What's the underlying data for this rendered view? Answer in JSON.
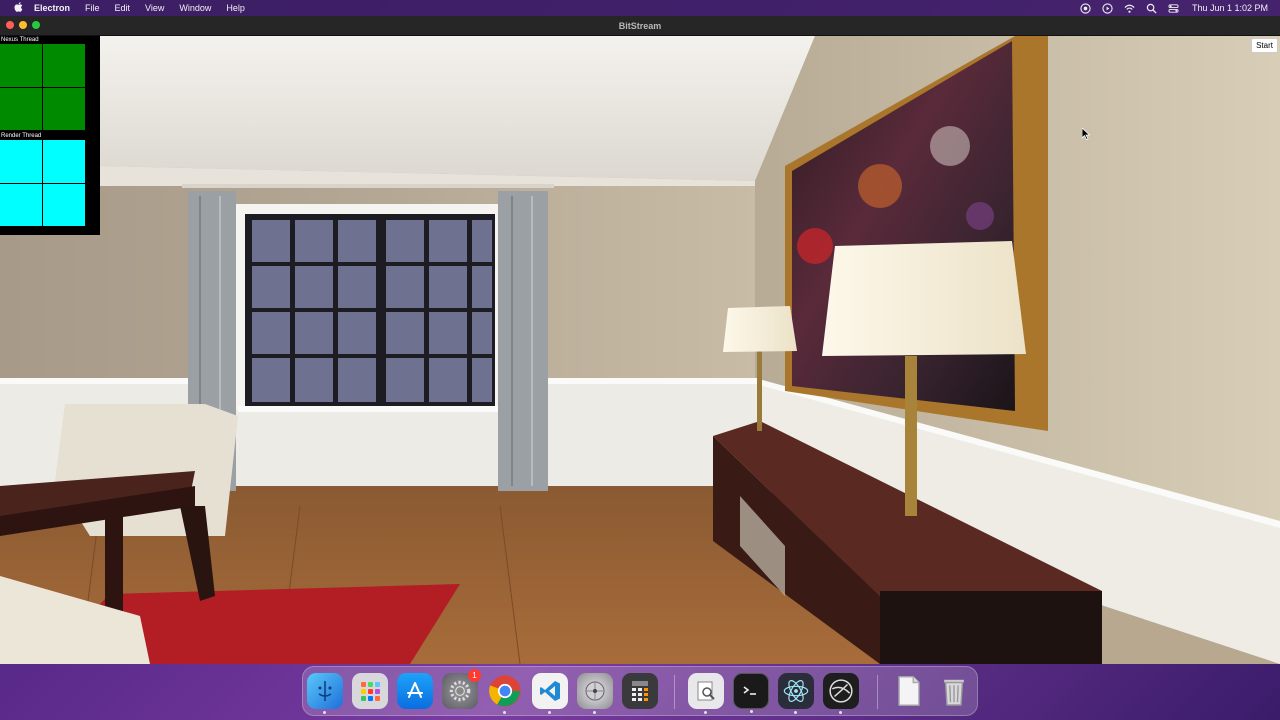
{
  "menubar": {
    "apple_icon": "apple-logo-icon",
    "app_name": "Electron",
    "items": [
      "File",
      "Edit",
      "View",
      "Window",
      "Help"
    ],
    "status_icons": [
      "screen-mirroring-icon",
      "media-play-icon",
      "wifi-icon",
      "search-icon",
      "control-center-icon"
    ],
    "clock": "Thu Jun 1  1:02 PM"
  },
  "window": {
    "title": "BitStream",
    "traffic_lights": {
      "close": "#ff5f57",
      "minimize": "#febc2e",
      "zoom": "#28c840"
    }
  },
  "debug": {
    "nexus_label": "Nexus Thread",
    "render_label": "Render Thread",
    "nexus_color": "#008a00",
    "render_color": "#00ffff"
  },
  "controls": {
    "start_label": "Start"
  },
  "scene": {
    "description_icon": "3d-room-render-icon"
  },
  "dock": {
    "items": [
      {
        "name": "finder-icon",
        "running": true
      },
      {
        "name": "launchpad-icon",
        "running": false
      },
      {
        "name": "app-store-icon",
        "running": false
      },
      {
        "name": "system-preferences-icon",
        "running": false,
        "badge": "1"
      },
      {
        "name": "chrome-icon",
        "running": true
      },
      {
        "name": "vscode-icon",
        "running": true
      },
      {
        "name": "disk-utility-icon",
        "running": true
      },
      {
        "name": "calculator-icon",
        "running": false
      },
      {
        "name": "preview-icon",
        "running": true
      },
      {
        "name": "terminal-icon",
        "running": true
      },
      {
        "name": "electron-icon",
        "running": true
      },
      {
        "name": "unity-icon",
        "running": true
      },
      {
        "name": "documents-folder-icon",
        "running": false
      },
      {
        "name": "trash-icon",
        "running": false
      }
    ]
  }
}
